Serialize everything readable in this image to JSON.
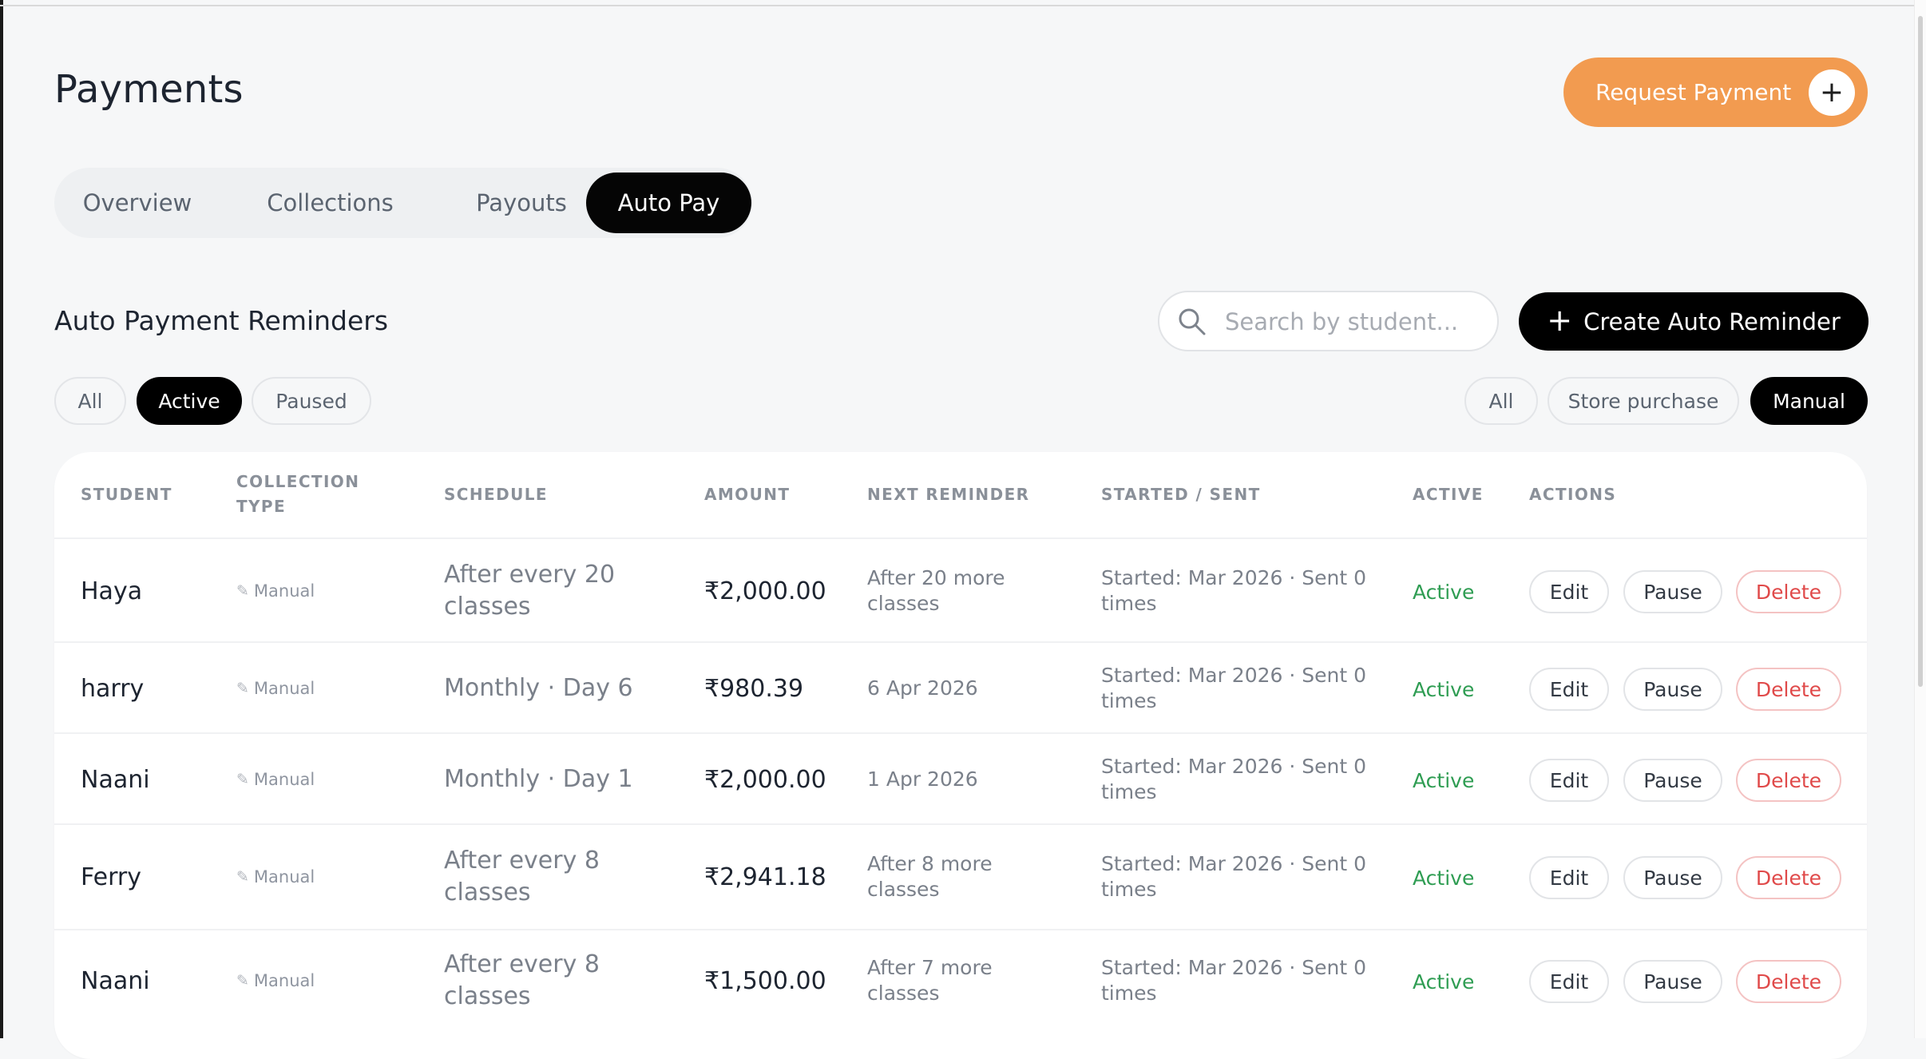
{
  "header": {
    "title": "Payments",
    "request_button_label": "Request Payment"
  },
  "tabs": [
    {
      "label": "Overview",
      "active": false
    },
    {
      "label": "Collections",
      "active": false
    },
    {
      "label": "Payouts",
      "active": false
    },
    {
      "label": "Auto Pay",
      "active": true
    }
  ],
  "section": {
    "title": "Auto Payment Reminders",
    "search_placeholder": "Search by student...",
    "create_button_label": "Create Auto Reminder"
  },
  "status_filters": [
    {
      "label": "All",
      "active": false
    },
    {
      "label": "Active",
      "active": true
    },
    {
      "label": "Paused",
      "active": false
    }
  ],
  "source_filters": [
    {
      "label": "All",
      "active": false
    },
    {
      "label": "Store purchase",
      "active": false
    },
    {
      "label": "Manual",
      "active": true
    }
  ],
  "table": {
    "columns": {
      "student": "STUDENT",
      "collection_type_1": "COLLECTION",
      "collection_type_2": "TYPE",
      "schedule": "SCHEDULE",
      "amount": "AMOUNT",
      "next_reminder": "NEXT REMINDER",
      "started_sent": "STARTED / SENT",
      "active": "ACTIVE",
      "actions": "ACTIONS"
    },
    "rows": [
      {
        "student": "Haya",
        "type": "Manual",
        "schedule_1": "After every 20",
        "schedule_2": "classes",
        "amount": "₹2,000.00",
        "next_1": "After 20 more",
        "next_2": "classes",
        "started_1": "Started: Mar 2026 · Sent 0",
        "started_2": "times",
        "status": "Active"
      },
      {
        "student": "harry",
        "type": "Manual",
        "schedule_1": "Monthly · Day 6",
        "schedule_2": "",
        "amount": "₹980.39",
        "next_1": "6 Apr 2026",
        "next_2": "",
        "started_1": "Started: Mar 2026 · Sent 0",
        "started_2": "times",
        "status": "Active"
      },
      {
        "student": "Naani",
        "type": "Manual",
        "schedule_1": "Monthly · Day 1",
        "schedule_2": "",
        "amount": "₹2,000.00",
        "next_1": "1 Apr 2026",
        "next_2": "",
        "started_1": "Started: Mar 2026 · Sent 0",
        "started_2": "times",
        "status": "Active"
      },
      {
        "student": "Ferry",
        "type": "Manual",
        "schedule_1": "After every 8",
        "schedule_2": "classes",
        "amount": "₹2,941.18",
        "next_1": "After 8 more",
        "next_2": "classes",
        "started_1": "Started: Mar 2026 · Sent 0",
        "started_2": "times",
        "status": "Active"
      },
      {
        "student": "Naani",
        "type": "Manual",
        "schedule_1": "After every 8",
        "schedule_2": "classes",
        "amount": "₹1,500.00",
        "next_1": "After 7 more",
        "next_2": "classes",
        "started_1": "Started: Mar 2026 · Sent 0",
        "started_2": "times",
        "status": "Active"
      }
    ],
    "action_labels": {
      "edit": "Edit",
      "pause": "Pause",
      "delete": "Delete"
    }
  },
  "icons": {
    "search": "search-icon",
    "plus": "plus-icon",
    "pencil": "pencil-icon"
  },
  "colors": {
    "accent_orange": "#f29b50",
    "active_green": "#2f9d53",
    "delete_red": "#e04a4a",
    "primary_black": "#000000"
  }
}
